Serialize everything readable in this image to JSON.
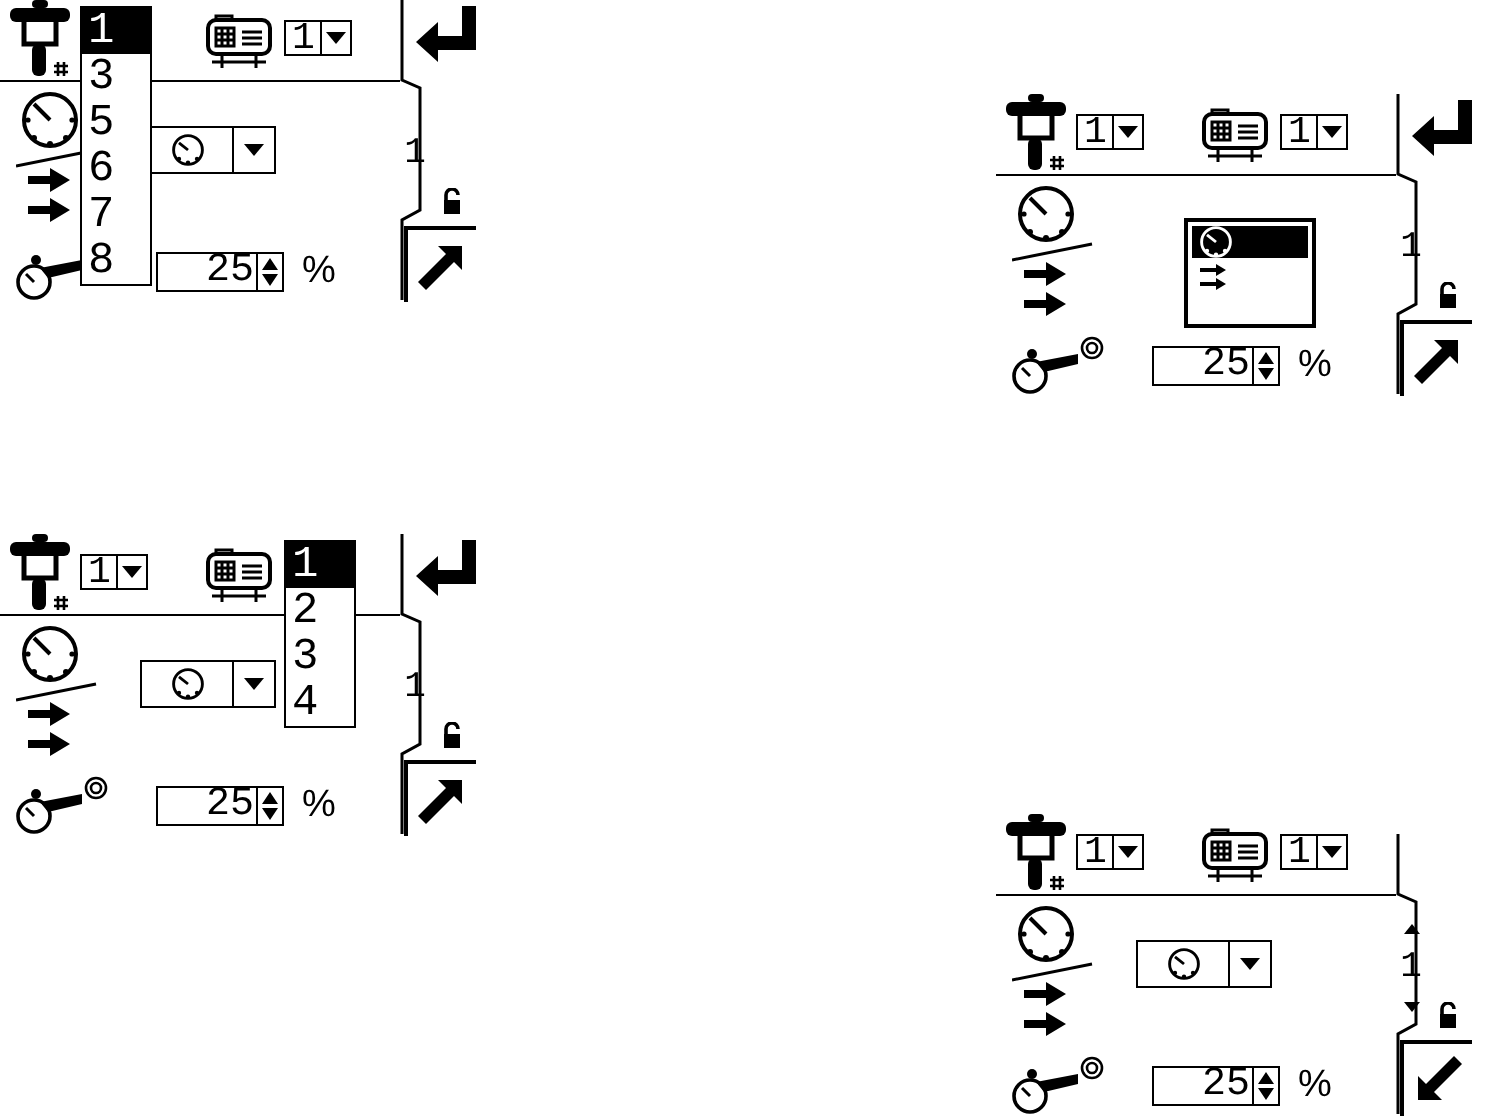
{
  "screens": [
    {
      "pump_select": {
        "open": true,
        "options": [
          {
            "label": "1",
            "selected": true
          },
          {
            "label": "3",
            "selected": false
          },
          {
            "label": "5",
            "selected": false
          },
          {
            "label": "6",
            "selected": false
          },
          {
            "label": "7",
            "selected": false
          },
          {
            "label": "8",
            "selected": false
          }
        ]
      },
      "module_select": {
        "open": false,
        "value": "1"
      },
      "mode_select": {
        "open": false,
        "kind": "pressure"
      },
      "target_marker": false,
      "setpoint": {
        "value": "25",
        "unit": "%"
      },
      "side": {
        "enter": true,
        "tab_label": "1",
        "scroll_arrows": false,
        "locked": true,
        "edit_button": {
          "kind": "out"
        }
      }
    },
    {
      "pump_select": {
        "open": false,
        "value": "1"
      },
      "module_select": {
        "open": false,
        "value": "1"
      },
      "mode_select": {
        "open": true,
        "options": [
          {
            "kind": "pressure",
            "selected": true
          },
          {
            "kind": "flow",
            "selected": false
          }
        ]
      },
      "target_marker": true,
      "setpoint": {
        "value": "25",
        "unit": "%"
      },
      "side": {
        "enter": true,
        "tab_label": "1",
        "scroll_arrows": false,
        "locked": true,
        "edit_button": {
          "kind": "out"
        }
      }
    },
    {
      "pump_select": {
        "open": false,
        "value": "1"
      },
      "module_select": {
        "open": true,
        "options": [
          {
            "label": "1",
            "selected": true
          },
          {
            "label": "2",
            "selected": false
          },
          {
            "label": "3",
            "selected": false
          },
          {
            "label": "4",
            "selected": false
          }
        ]
      },
      "mode_select": {
        "open": false,
        "kind": "pressure"
      },
      "target_marker": true,
      "setpoint": {
        "value": "25",
        "unit": "%"
      },
      "side": {
        "enter": true,
        "tab_label": "1",
        "scroll_arrows": false,
        "locked": true,
        "edit_button": {
          "kind": "out"
        }
      }
    },
    {
      "pump_select": {
        "open": false,
        "value": "1"
      },
      "module_select": {
        "open": false,
        "value": "1"
      },
      "mode_select": {
        "open": false,
        "kind": "pressure"
      },
      "target_marker": true,
      "setpoint": {
        "value": "25",
        "unit": "%"
      },
      "side": {
        "enter": false,
        "tab_label": "1",
        "scroll_arrows": true,
        "locked": true,
        "edit_button": {
          "kind": "in"
        }
      }
    }
  ]
}
